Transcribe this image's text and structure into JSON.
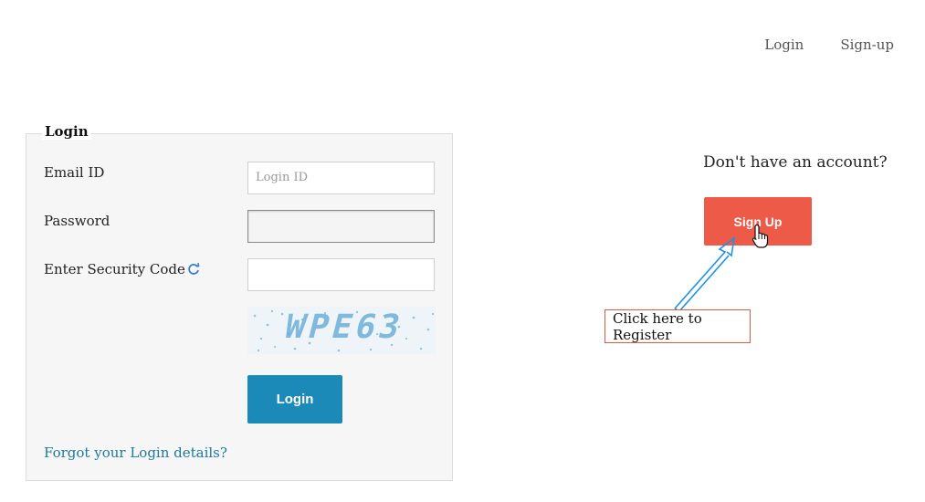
{
  "topnav": {
    "login": "Login",
    "signup": "Sign-up"
  },
  "login_panel": {
    "legend": "Login",
    "email_label": "Email ID",
    "email_placeholder": "Login ID",
    "password_label": "Password",
    "security_label": "Enter Security Code",
    "captcha_text": "WPE63",
    "login_button": "Login",
    "forgot_link": "Forgot your Login details?"
  },
  "signup_section": {
    "prompt": "Don't have an account?",
    "button": "Sign Up",
    "callout": "Click here to Register"
  },
  "colors": {
    "login_button": "#1b8ab8",
    "signup_button": "#ee5a48",
    "callout_border": "#e05a3f",
    "arrow": "#1e90e8"
  },
  "icons": [
    "refresh-icon",
    "hand-cursor-icon",
    "arrow-icon"
  ]
}
